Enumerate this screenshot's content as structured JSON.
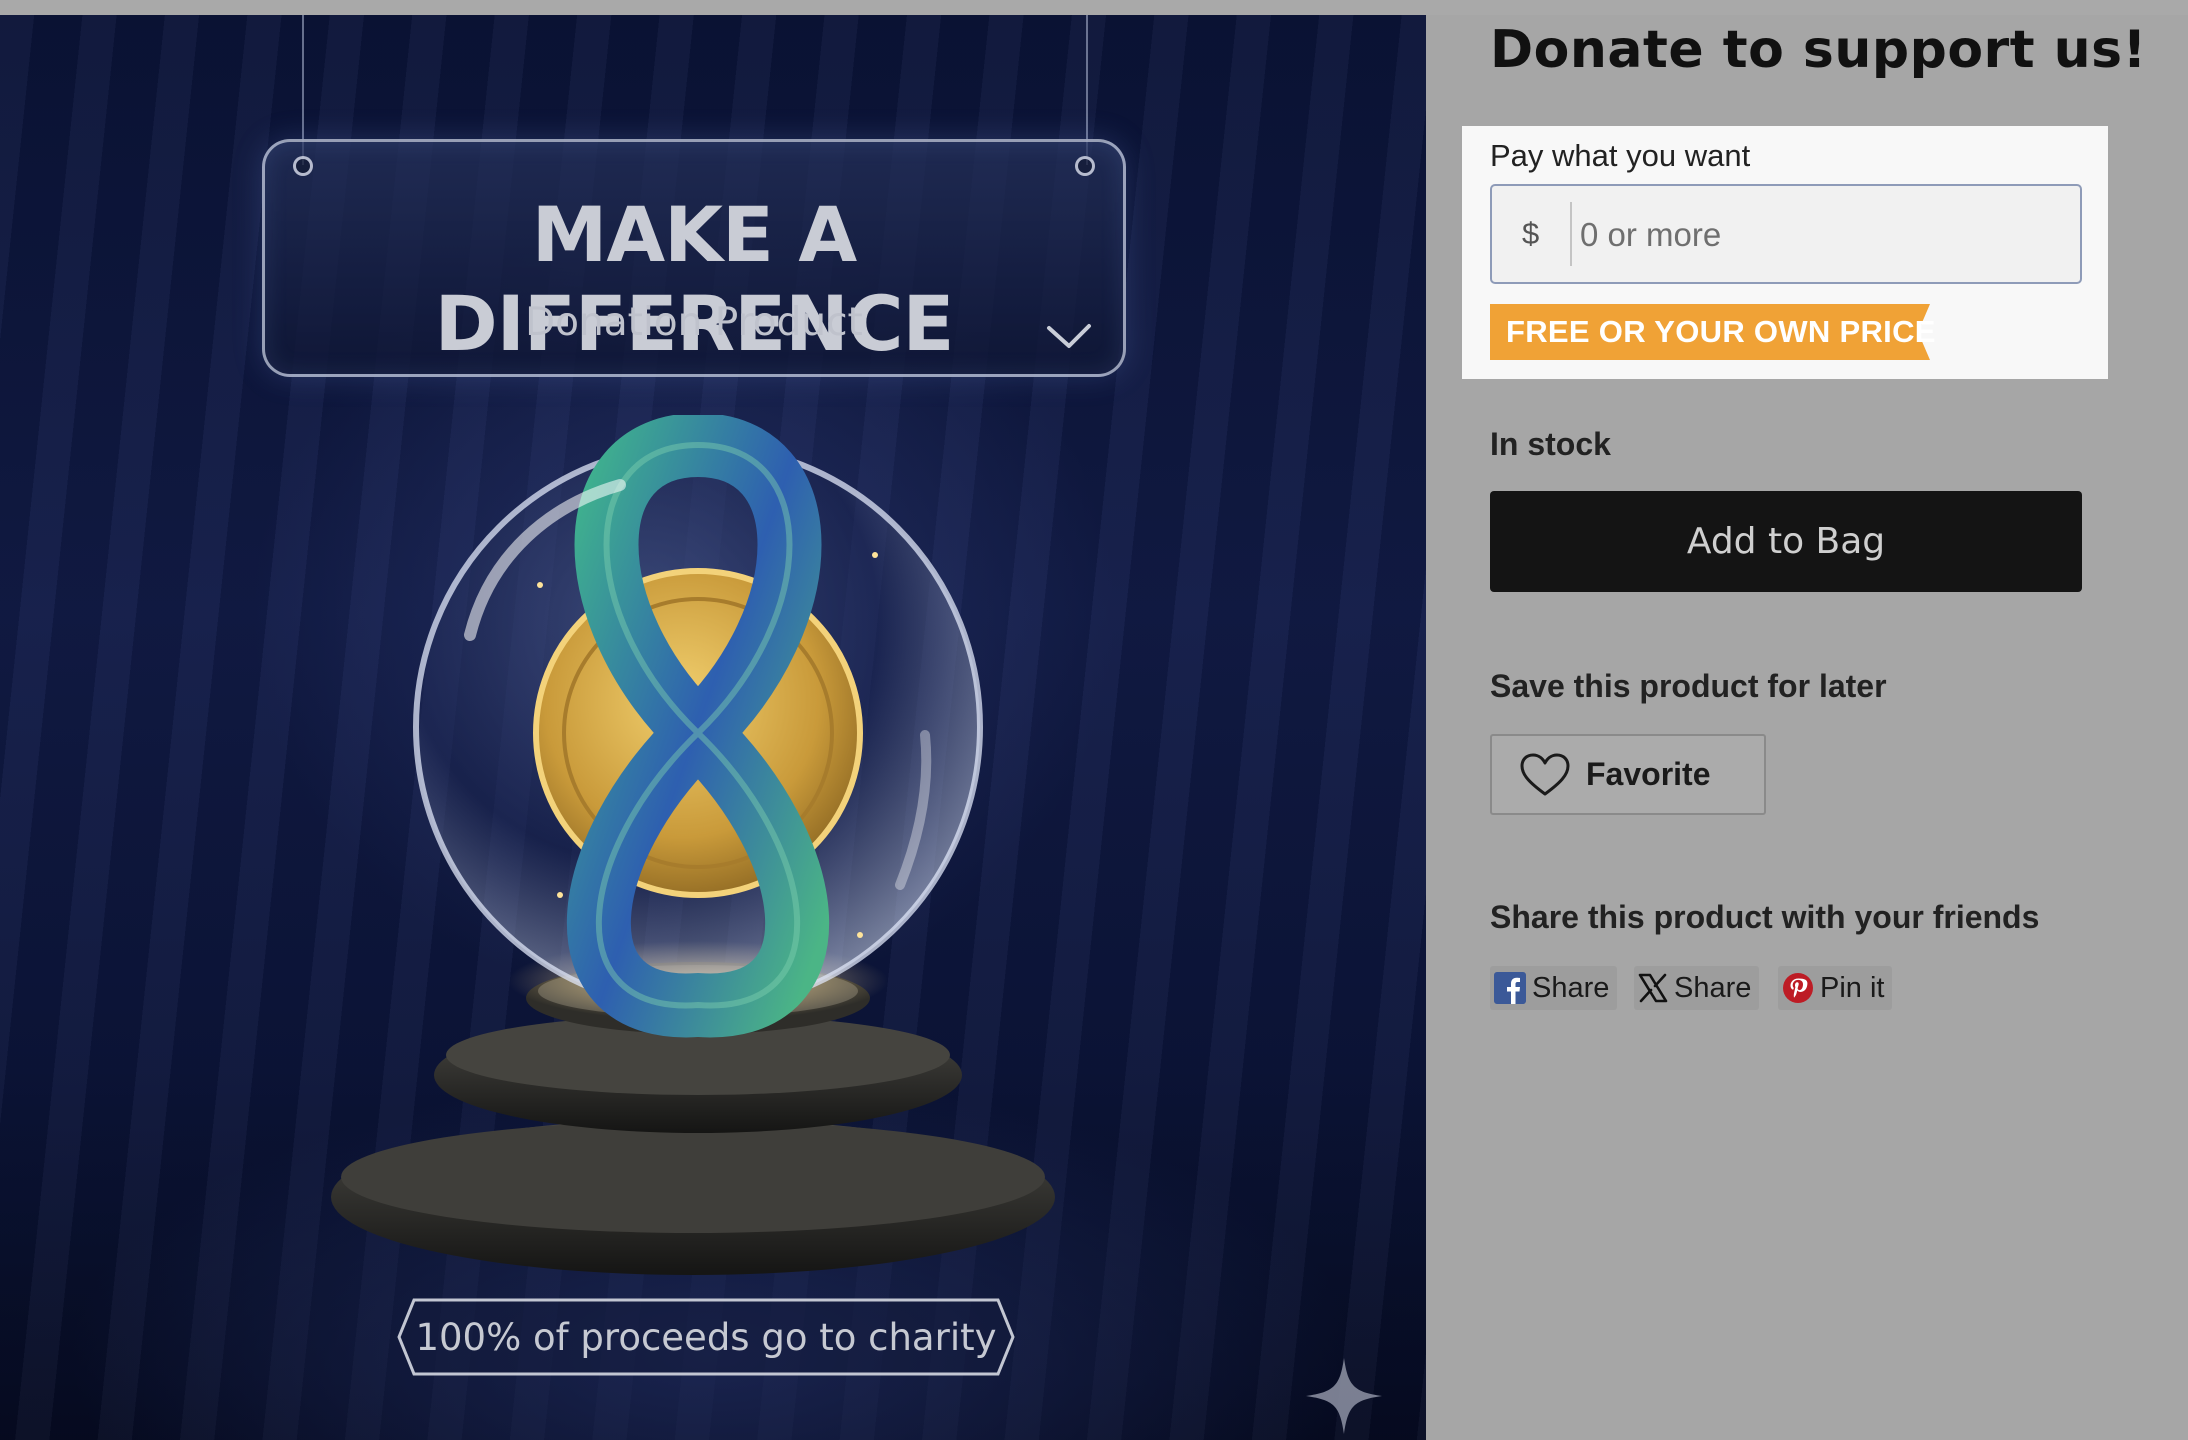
{
  "hero": {
    "sign_title": "MAKE A DIFFERENCE",
    "sign_subtitle": "Donation Product",
    "charity_text": "100% of proceeds go to charity"
  },
  "product": {
    "title": "Donate to support us!",
    "pay_label": "Pay what you want",
    "currency_symbol": "$",
    "price_placeholder": "0 or more",
    "price_value": "",
    "price_badge": "FREE OR YOUR OWN PRICE",
    "stock_status": "In stock",
    "add_button": "Add to Bag",
    "save_label": "Save this product for later",
    "favorite_button": "Favorite",
    "share_label": "Share this product with your friends",
    "share_buttons": [
      {
        "icon": "facebook-icon",
        "label": "Share"
      },
      {
        "icon": "x-icon",
        "label": "Share"
      },
      {
        "icon": "pinterest-icon",
        "label": "Pin it"
      }
    ]
  },
  "colors": {
    "badge": "#f0a236",
    "button": "#141414",
    "panel_background": "#a6a6a6",
    "highlight_box": "#f8f8f8",
    "facebook": "#3b5998",
    "pinterest": "#bd1c25"
  }
}
